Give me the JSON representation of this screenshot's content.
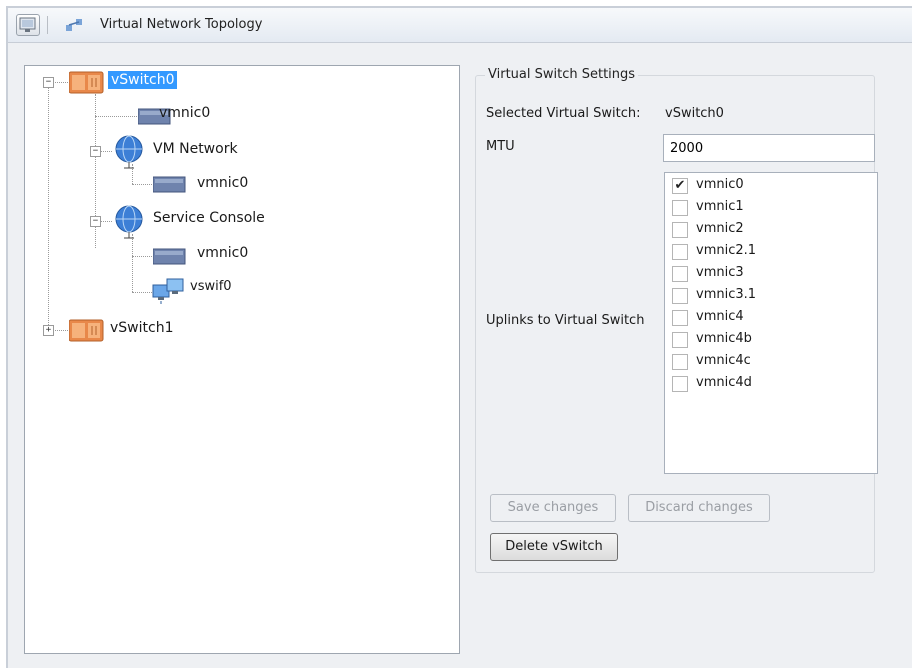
{
  "window": {
    "title": "Virtual Network Topology"
  },
  "tree": {
    "vswitch0": "vSwitch0",
    "vswitch0_vmnic": "vmnic0",
    "vm_network": "VM Network",
    "vm_network_vmnic": "vmnic0",
    "service_console": "Service Console",
    "service_console_vmnic": "vmnic0",
    "service_console_vswif": "vswif0",
    "vswitch1": "vSwitch1"
  },
  "settings": {
    "group_title": "Virtual Switch Settings",
    "selected_label": "Selected Virtual Switch:",
    "selected_value": "vSwitch0",
    "mtu_label": "MTU",
    "mtu_value": "2000",
    "uplinks_label": "Uplinks to Virtual Switch",
    "uplinks": [
      {
        "name": "vmnic0",
        "checked": true
      },
      {
        "name": "vmnic1",
        "checked": false
      },
      {
        "name": "vmnic2",
        "checked": false
      },
      {
        "name": "vmnic2.1",
        "checked": false
      },
      {
        "name": "vmnic3",
        "checked": false
      },
      {
        "name": "vmnic3.1",
        "checked": false
      },
      {
        "name": "vmnic4",
        "checked": false
      },
      {
        "name": "vmnic4b",
        "checked": false
      },
      {
        "name": "vmnic4c",
        "checked": false
      },
      {
        "name": "vmnic4d",
        "checked": false
      }
    ],
    "save_label": "Save changes",
    "discard_label": "Discard changes",
    "delete_label": "Delete vSwitch",
    "check_glyph": "✔"
  },
  "colors": {
    "selection": "#3399ff",
    "switch_icon": "#e8884a",
    "nic_icon": "#5b6f9a",
    "globe_icon": "#3d7fd6"
  },
  "expander_glyphs": {
    "collapse": "−",
    "expand": "+"
  }
}
